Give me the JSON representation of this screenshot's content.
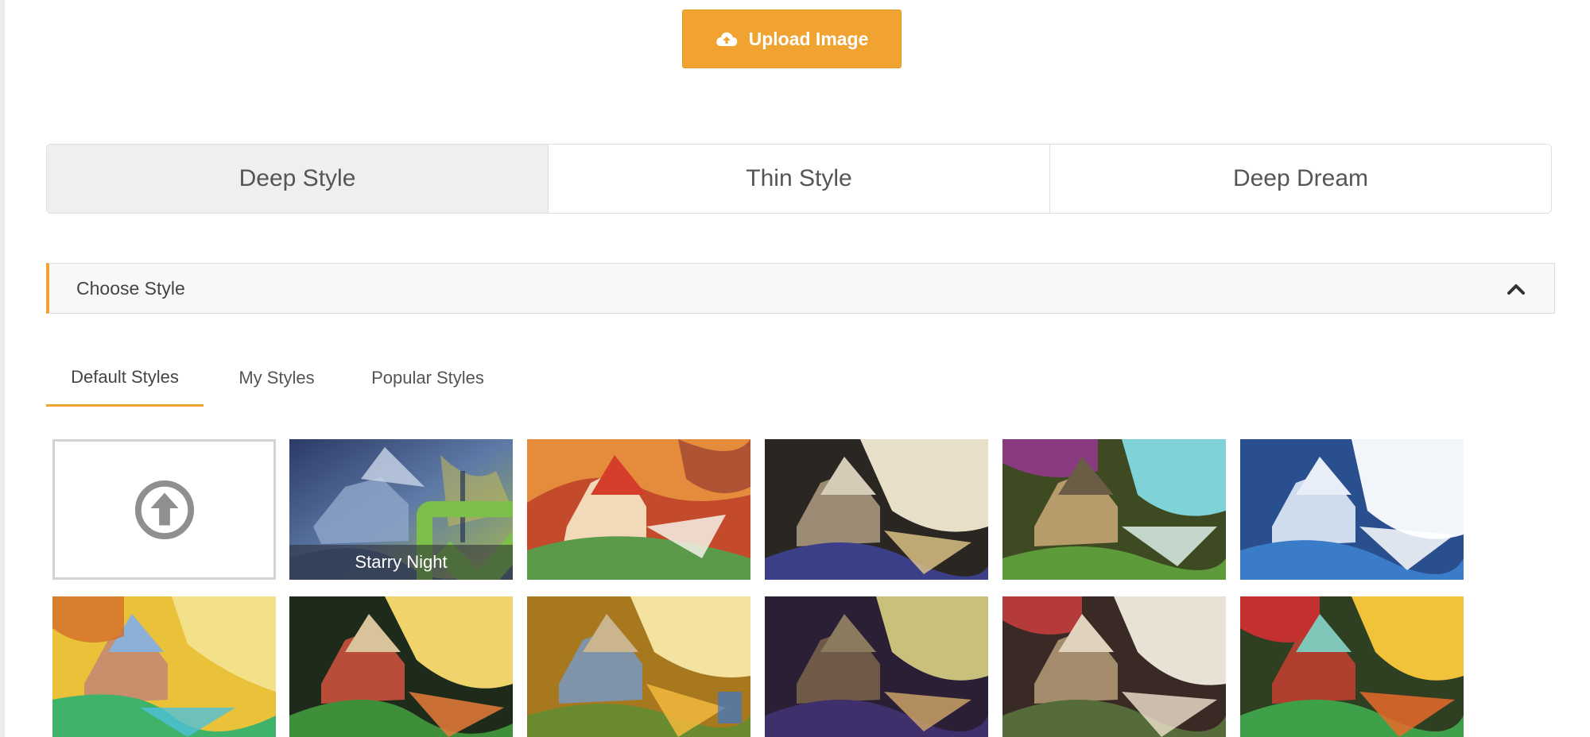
{
  "upload": {
    "label": "Upload Image",
    "icon": "cloud-upload-icon"
  },
  "mode_tabs": [
    {
      "label": "Deep Style",
      "active": true
    },
    {
      "label": "Thin Style",
      "active": false
    },
    {
      "label": "Deep Dream",
      "active": false
    }
  ],
  "accordion": {
    "title": "Choose Style",
    "icon": "chevron-up-icon",
    "expanded": true
  },
  "style_tabs": [
    {
      "label": "Default Styles",
      "active": true
    },
    {
      "label": "My Styles",
      "active": false
    },
    {
      "label": "Popular Styles",
      "active": false
    }
  ],
  "selected_style": {
    "label": "Starry Night",
    "icon": "checkbox-checked-icon"
  },
  "colors": {
    "accent": "#f0a331",
    "active_tab_bg": "#efefef",
    "check": "#7cc04b"
  }
}
